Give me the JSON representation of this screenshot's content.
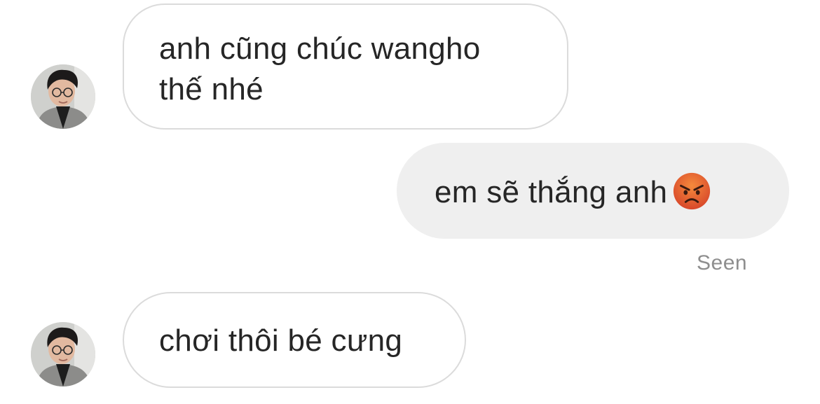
{
  "thread": {
    "messages": [
      {
        "direction": "incoming",
        "lines": [
          "anh cũng chúc wangho",
          "thế nhé"
        ]
      },
      {
        "direction": "outgoing",
        "text": "em sẽ thắng anh",
        "emoji": "angry-face-emoji"
      },
      {
        "direction": "incoming",
        "text": "chơi thôi bé cưng"
      }
    ],
    "seen_label": "Seen"
  },
  "colors": {
    "incoming_border": "#dbdbdb",
    "outgoing_fill": "#efefef",
    "text": "#262626",
    "meta_text": "#8e8e8e",
    "emoji_face": "#e8632b"
  }
}
